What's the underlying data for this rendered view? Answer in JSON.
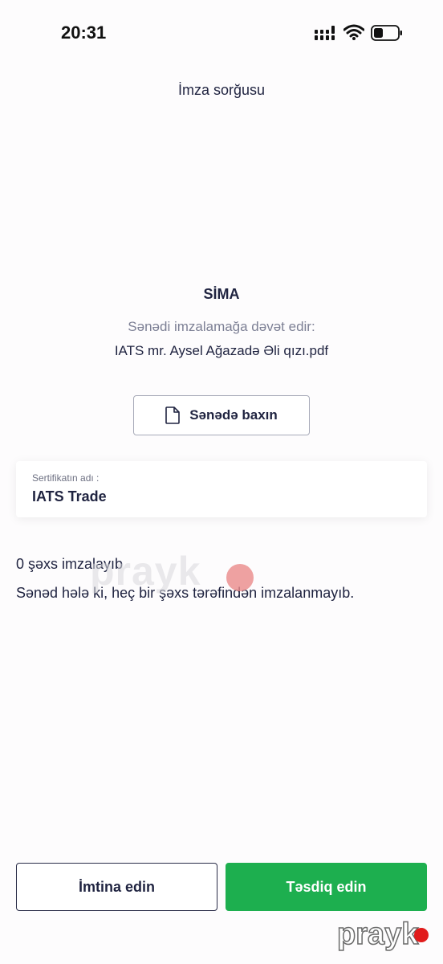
{
  "status_bar": {
    "time": "20:31"
  },
  "header": {
    "title": "İmza sorğusu"
  },
  "request": {
    "issuer": "SİMA",
    "invite_text": "Sənədi imzalamağa dəvət edir:",
    "file_name": "IATS mr. Aysel Ağazadə Əli qızı.pdf",
    "view_button_label": "Sənədə baxın",
    "view_button_icon": "document-icon"
  },
  "certificate": {
    "caption": "Sertifikatın adı :",
    "value": "IATS Trade"
  },
  "signatures": {
    "count_text": "0 şəxs imzalayıb",
    "info_text": "Sənəd hələ ki, heç bir şəxs tərəfindən imzalanmayıb."
  },
  "actions": {
    "reject_label": "İmtina edin",
    "confirm_label": "Təsdiq edin"
  },
  "watermark": {
    "text": "prayk"
  },
  "logo": {
    "text": "prayk"
  },
  "colors": {
    "primary_text": "#1f2340",
    "secondary_text": "#7d8095",
    "confirm_green": "#1daf4f",
    "logo_red": "#e11b1b"
  }
}
